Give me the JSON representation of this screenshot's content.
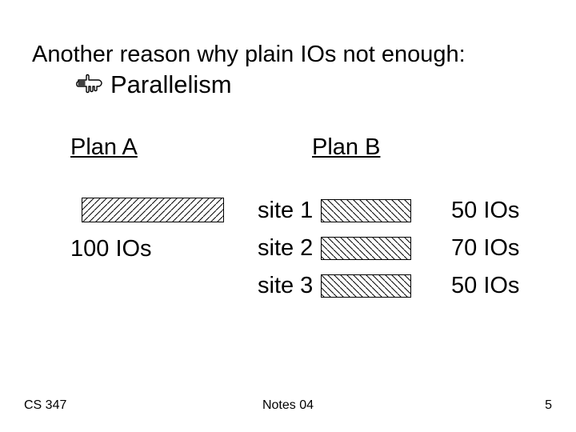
{
  "title": {
    "line1": "Another reason why plain IOs not enough:",
    "line2": "Parallelism"
  },
  "icons": {
    "pointer": "pointing-hand"
  },
  "plans": {
    "a": {
      "label": "Plan A",
      "ios": "100 IOs"
    },
    "b": {
      "label": "Plan B",
      "rows": [
        {
          "site": "site 1",
          "ios": "50 IOs"
        },
        {
          "site": "site 2",
          "ios": "70 IOs"
        },
        {
          "site": "site 3",
          "ios": "50 IOs"
        }
      ]
    }
  },
  "footer": {
    "left": "CS 347",
    "center": "Notes 04",
    "right": "5"
  },
  "chart_data": {
    "type": "table",
    "title": "Plan A vs Plan B IO costs",
    "plan_a": {
      "total_ios": 100
    },
    "plan_b": {
      "sites": [
        "site 1",
        "site 2",
        "site 3"
      ],
      "ios": [
        50,
        70,
        50
      ]
    }
  }
}
